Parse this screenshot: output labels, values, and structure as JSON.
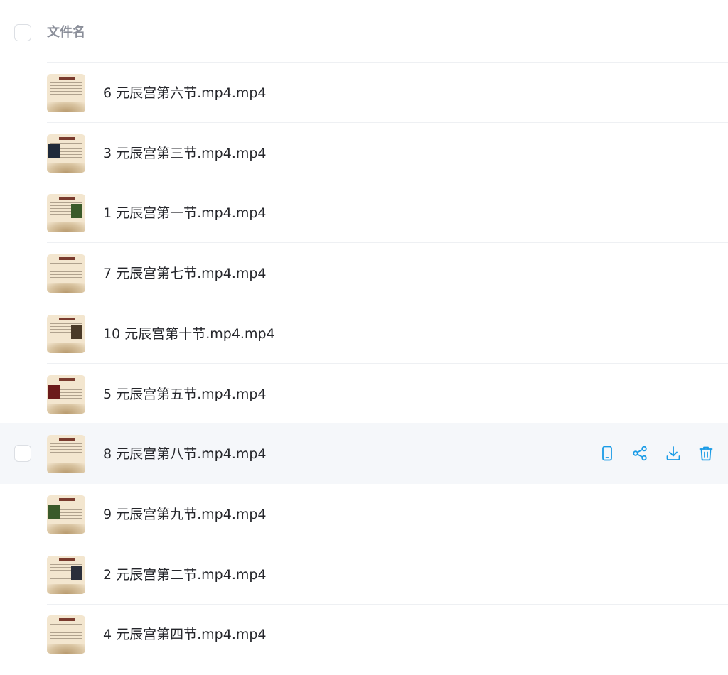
{
  "header": {
    "column_label": "文件名"
  },
  "files": [
    {
      "name": "6 元辰宫第六节.mp4.mp4",
      "thumbnail": "video-thumbnail"
    },
    {
      "name": "3 元辰宫第三节.mp4.mp4",
      "thumbnail": "video-thumbnail"
    },
    {
      "name": "1 元辰宫第一节.mp4.mp4",
      "thumbnail": "video-thumbnail"
    },
    {
      "name": "7 元辰宫第七节.mp4.mp4",
      "thumbnail": "video-thumbnail"
    },
    {
      "name": "10 元辰宫第十节.mp4.mp4",
      "thumbnail": "video-thumbnail"
    },
    {
      "name": "5 元辰宫第五节.mp4.mp4",
      "thumbnail": "video-thumbnail"
    },
    {
      "name": "8 元辰宫第八节.mp4.mp4",
      "thumbnail": "video-thumbnail",
      "hovered": true
    },
    {
      "name": "9 元辰宫第九节.mp4.mp4",
      "thumbnail": "video-thumbnail"
    },
    {
      "name": "2 元辰宫第二节.mp4.mp4",
      "thumbnail": "video-thumbnail"
    },
    {
      "name": "4 元辰宫第四节.mp4.mp4",
      "thumbnail": "video-thumbnail"
    }
  ],
  "row_actions": [
    {
      "name": "phone-icon",
      "label": "phone"
    },
    {
      "name": "share-icon",
      "label": "share"
    },
    {
      "name": "download-icon",
      "label": "download"
    },
    {
      "name": "trash-icon",
      "label": "delete"
    }
  ],
  "colors": {
    "accent": "#1a9be6",
    "hover_row_bg": "#f5f7fa",
    "header_text": "#8a8e99",
    "text": "#25262b",
    "divider": "#eef0f3"
  }
}
